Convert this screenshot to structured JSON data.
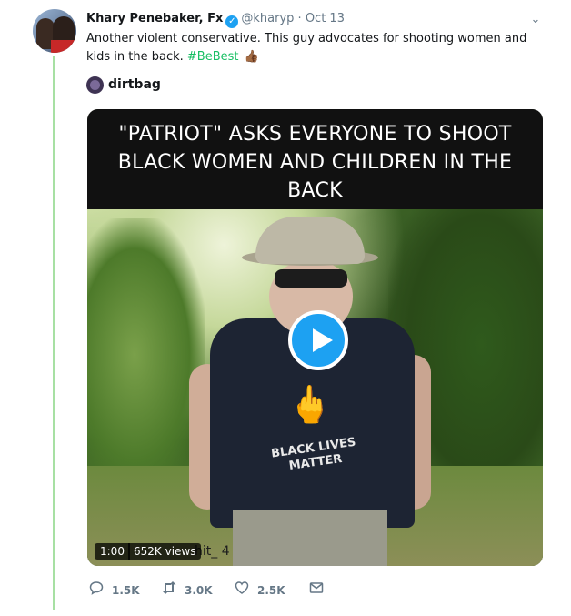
{
  "tweet": {
    "author_name": "Khary Penebaker, Fx",
    "handle": "@kharyp",
    "separator": "·",
    "date": "Oct 13",
    "text": "Another violent conservative. This guy advocates for shooting women and kids in the back. ",
    "hashtag": "#BeBest",
    "emoji": "👍🏾"
  },
  "quoted": {
    "name": "dirtbag"
  },
  "video": {
    "caption_lines": [
      "\"PATRIOT\" ASKS EVERYONE TO SHOOT",
      "BLACK WOMEN AND CHILDREN IN THE",
      "BACK"
    ],
    "shirt_text": "BLACK LIVES MATTER",
    "duration": "1:00",
    "views": "652K views",
    "watermark": "hit_ 4"
  },
  "actions": {
    "replies": "1.5K",
    "retweets": "3.0K",
    "likes": "2.5K"
  },
  "icons": {
    "verified": "verified-badge-icon",
    "chevron": "chevron-down-icon",
    "reply": "reply-icon",
    "retweet": "retweet-icon",
    "like": "heart-icon",
    "dm": "envelope-icon",
    "play": "play-icon"
  },
  "colors": {
    "accent": "#1da1f2",
    "hashtag": "#17bf63",
    "thread_line": "#a7e0a3",
    "muted_text": "#657786"
  }
}
